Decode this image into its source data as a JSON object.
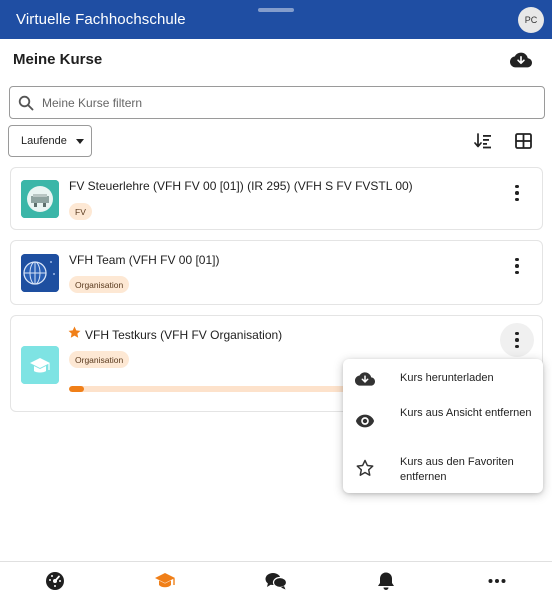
{
  "header": {
    "title": "Virtuelle Fachhochschule",
    "avatar_initials": "PC",
    "color": "#1f4ea3"
  },
  "page": {
    "title": "Meine Kurse"
  },
  "search": {
    "placeholder": "Meine Kurse filtern",
    "value": ""
  },
  "filter": {
    "selected": "Laufende"
  },
  "courses": [
    {
      "title": "FV Steuerlehre (VFH FV 00 [01]) (IR 295) (VFH S FV FVSTL 00)",
      "badge": "FV",
      "favorite": false
    },
    {
      "title": "VFH Team (VFH FV 00 [01])",
      "badge": "Organisation",
      "favorite": false
    },
    {
      "title": "VFH Testkurs (VFH FV Organisation)",
      "badge": "Organisation",
      "favorite": true,
      "progress": 0.05
    }
  ],
  "menu": {
    "items": [
      {
        "label": "Kurs herunterladen",
        "icon": "cloud-download-icon"
      },
      {
        "label": "Kurs aus Ansicht entfernen",
        "icon": "eye-icon"
      },
      {
        "label": "Kurs aus den Favoriten entfernen",
        "icon": "star-outline-icon"
      }
    ]
  },
  "bottom_nav": [
    {
      "name": "dashboard-icon",
      "active": false
    },
    {
      "name": "courses-icon",
      "active": true
    },
    {
      "name": "messages-icon",
      "active": false
    },
    {
      "name": "notifications-icon",
      "active": false
    },
    {
      "name": "more-icon",
      "active": false
    }
  ],
  "colors": {
    "accent": "#f07f18",
    "badge_bg": "#fde8d4",
    "header": "#1f4ea3"
  }
}
